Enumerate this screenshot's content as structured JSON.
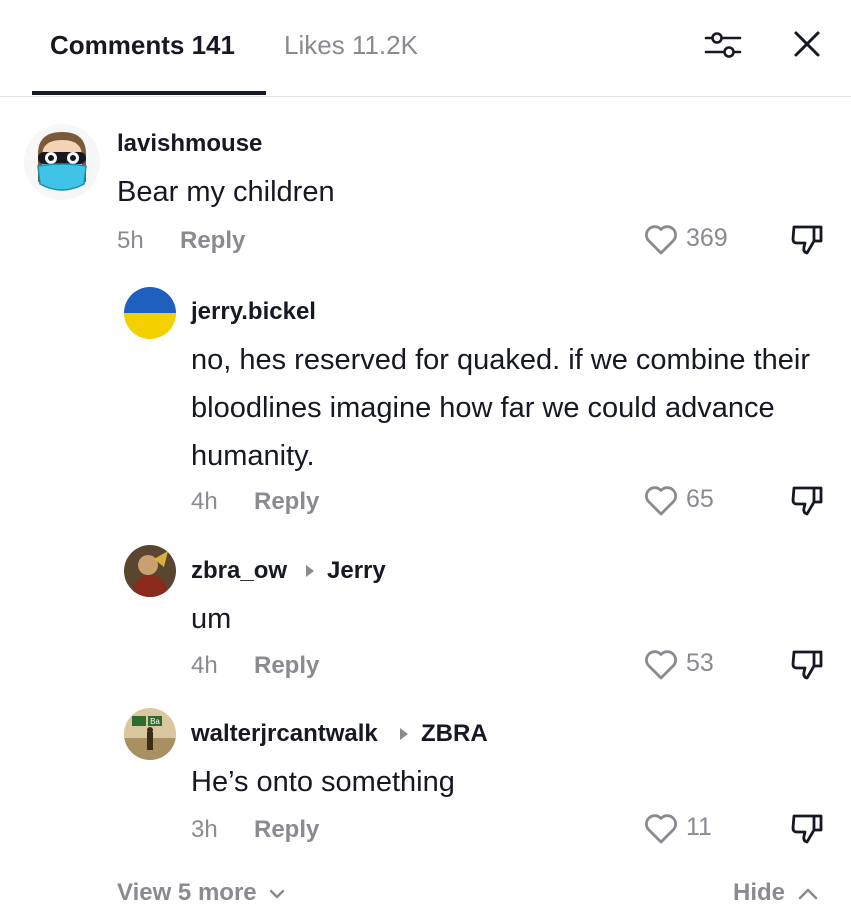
{
  "header": {
    "comments_tab": "Comments 141",
    "likes_tab": "Likes 11.2K",
    "filter_icon": "sliders-icon",
    "close_icon": "close-icon"
  },
  "comments": [
    {
      "username": "lavishmouse",
      "text": "Bear my children",
      "time": "5h",
      "reply_label": "Reply",
      "likes": "369"
    },
    {
      "username": "jerry.bickel",
      "text": "no, hes reserved for quaked. if we combine their bloodlines imagine how far we could advance humanity.",
      "time": "4h",
      "reply_label": "Reply",
      "likes": "65"
    },
    {
      "username": "zbra_ow",
      "reply_to": "Jerry",
      "text": "um",
      "time": "4h",
      "reply_label": "Reply",
      "likes": "53"
    },
    {
      "username": "walterjrcantwalk",
      "reply_to": "ZBRA",
      "avatar_text": "Ba",
      "text": "He’s onto something",
      "time": "3h",
      "reply_label": "Reply",
      "likes": "11"
    }
  ],
  "footer": {
    "view_more": "View 5 more",
    "hide": "Hide"
  },
  "colors": {
    "text_primary": "#161823",
    "text_secondary": "#8a8b91",
    "ukraine_blue": "#1f5fbf",
    "ukraine_yellow": "#f5d000",
    "mask_cyan": "#3fc3e6"
  }
}
